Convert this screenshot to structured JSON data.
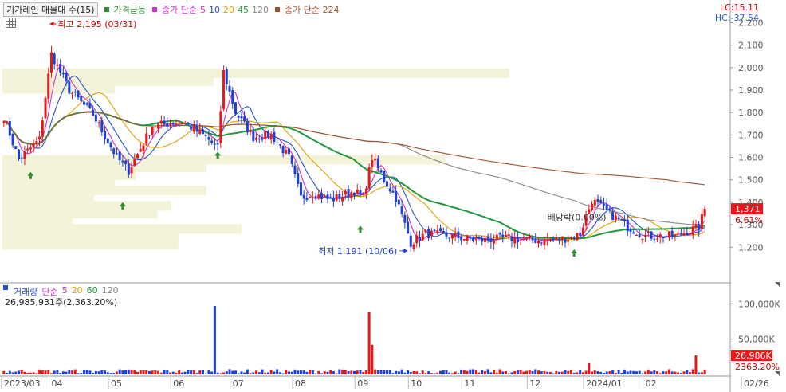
{
  "legend": {
    "title": "기가레인 매물대 수(15)",
    "signal": "가격급등",
    "ma_label": "종가 단순",
    "ma_periods": [
      "5",
      "10",
      "20",
      "45",
      "120"
    ],
    "long_ma": "종가 단순 224",
    "colors": {
      "signal": "#2e8b2e",
      "ma5": "#cc33cc",
      "ma10": "#2255cc",
      "ma20": "#e0a000",
      "ma45": "#1f9a3a",
      "ma120": "#888888",
      "ma224": "#a0522d"
    }
  },
  "indicators": {
    "lc": "LC:15.11",
    "hc": "HC:-37.54"
  },
  "current": {
    "price_label": "1,371",
    "change_label": "6.61%"
  },
  "annotations": {
    "high": "최고 2,195 (03/31)",
    "low": "최저 1,191 (10/06)",
    "dividend": "배당락(0.00%)"
  },
  "volume": {
    "legend_title": "거래량",
    "ma_label": "단순",
    "ma_periods": [
      "5",
      "20",
      "60",
      "120"
    ],
    "last_line": "26,985,931주(2,363.20%)",
    "current_label": "26,986K",
    "ratio_label": "2363.20%",
    "ticks": [
      "100,000K",
      "50,000K"
    ]
  },
  "chart_data": {
    "type": "candlestick",
    "price_ticks": [
      {
        "label": "2,200",
        "v": 2200
      },
      {
        "label": "2,100",
        "v": 2100
      },
      {
        "label": "2,000",
        "v": 2000
      },
      {
        "label": "1,900",
        "v": 1900
      },
      {
        "label": "1,800",
        "v": 1800
      },
      {
        "label": "1,700",
        "v": 1700
      },
      {
        "label": "1,600",
        "v": 1600
      },
      {
        "label": "1,500",
        "v": 1500
      },
      {
        "label": "1,400",
        "v": 1400
      },
      {
        "label": "1,300",
        "v": 1300
      },
      {
        "label": "1,200",
        "v": 1200
      }
    ],
    "price_range": [
      1130,
      2230
    ],
    "volume_ticks": [
      {
        "label": "100,000K",
        "v": 100000
      },
      {
        "label": "50,000K",
        "v": 50000
      }
    ],
    "volume_range": [
      0,
      115000
    ],
    "x_labels": [
      {
        "label": "2023/03",
        "i": 0
      },
      {
        "label": "04",
        "i": 16
      },
      {
        "label": "05",
        "i": 36
      },
      {
        "label": "06",
        "i": 57
      },
      {
        "label": "07",
        "i": 77
      },
      {
        "label": "08",
        "i": 98
      },
      {
        "label": "09",
        "i": 119
      },
      {
        "label": "10",
        "i": 137
      },
      {
        "label": "11",
        "i": 155
      },
      {
        "label": "12",
        "i": 177
      },
      {
        "label": "2024/01",
        "i": 196
      },
      {
        "label": "02",
        "i": 216
      },
      {
        "label": "02/26",
        "i": 236
      }
    ],
    "n_bars": 237,
    "high": {
      "value": 2195,
      "date": "03/31"
    },
    "low": {
      "value": 1191,
      "date": "10/06"
    },
    "last_close": 1371,
    "volume_profile": [
      {
        "price": 1590,
        "width": 0.63
      },
      {
        "price": 1555,
        "width": 0.29
      },
      {
        "price": 1520,
        "width": 0.19
      },
      {
        "price": 1487,
        "width": 0.16
      },
      {
        "price": 1453,
        "width": 0.29
      },
      {
        "price": 1418,
        "width": 0.13
      },
      {
        "price": 1384,
        "width": 0.24
      },
      {
        "price": 1350,
        "width": 0.22
      },
      {
        "price": 1316,
        "width": 0.1
      },
      {
        "price": 1281,
        "width": 0.34
      },
      {
        "price": 1247,
        "width": 0.25
      },
      {
        "price": 1212,
        "width": 0.25
      },
      {
        "price": 1975,
        "width": 0.72
      },
      {
        "price": 1940,
        "width": 0.3
      },
      {
        "price": 1905,
        "width": 0.16
      }
    ],
    "signals": [
      {
        "i": 9,
        "price": 1585
      },
      {
        "i": 40,
        "price": 1450
      },
      {
        "i": 72,
        "price": 1675
      },
      {
        "i": 120,
        "price": 1345
      },
      {
        "i": 192,
        "price": 1240
      }
    ],
    "volume_spikes": [
      {
        "i": 71,
        "v": 97000
      },
      {
        "i": 123,
        "v": 88000
      },
      {
        "i": 124,
        "v": 42000
      },
      {
        "i": 197,
        "v": 16000
      },
      {
        "i": 233,
        "v": 26986
      }
    ]
  }
}
